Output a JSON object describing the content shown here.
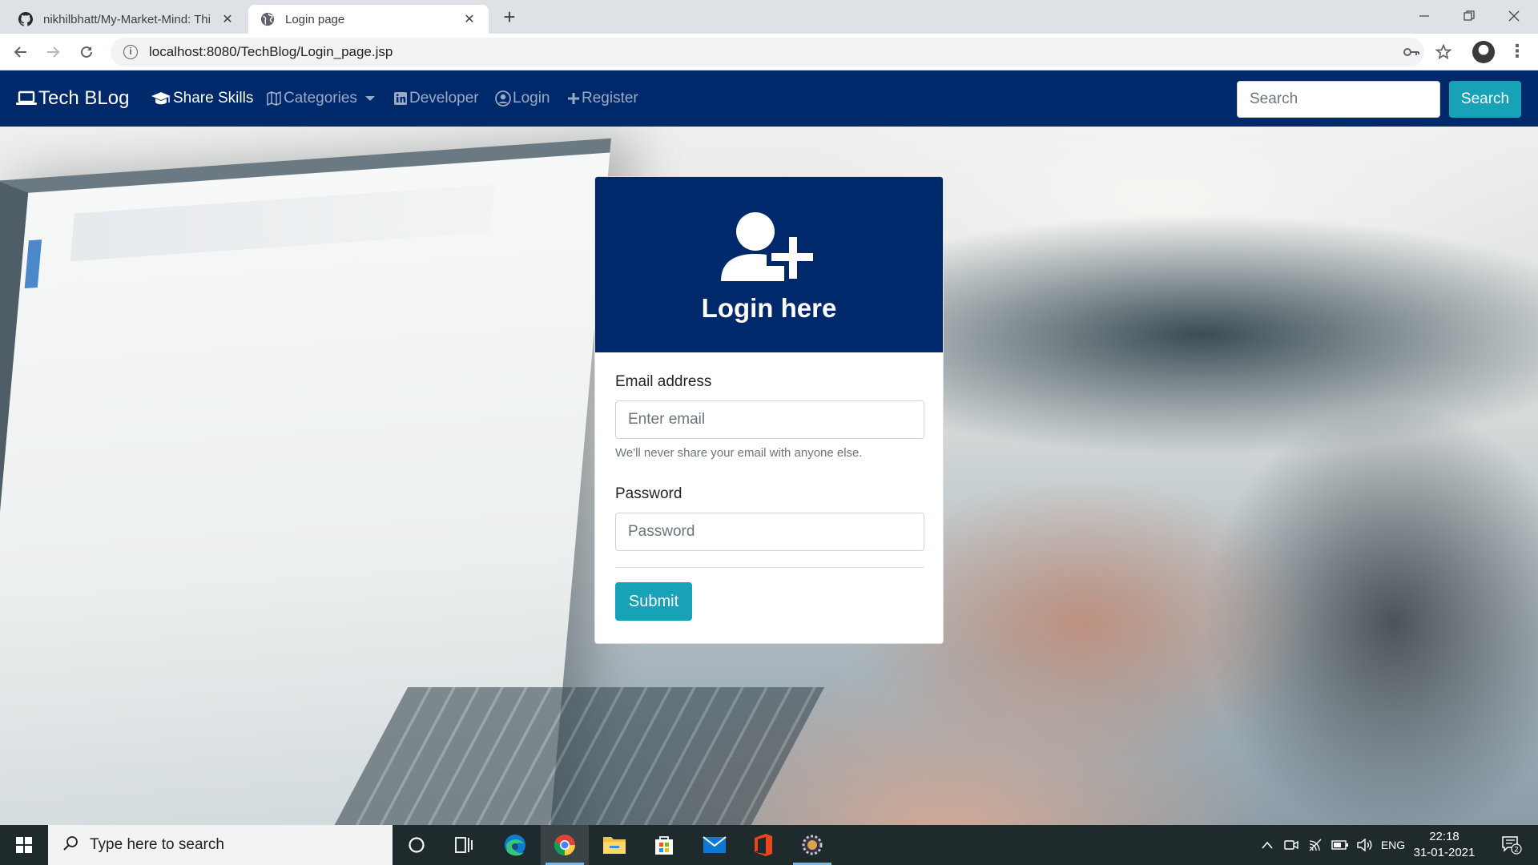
{
  "browser": {
    "tabs": [
      {
        "title": "nikhilbhatt/My-Market-Mind: Thi",
        "icon": "github-icon",
        "active": false
      },
      {
        "title": "Login page",
        "icon": "globe-icon",
        "active": true
      }
    ],
    "address_bar": {
      "url": "localhost:8080/TechBlog/Login_page.jsp"
    }
  },
  "site": {
    "brand": "Tech BLog",
    "nav": {
      "share_skills": "Share Skills",
      "categories": "Categories",
      "developer": "Developer",
      "login": "Login",
      "register": "Register"
    },
    "search": {
      "placeholder": "Search",
      "button": "Search"
    }
  },
  "login_card": {
    "title": "Login here",
    "email_label": "Email address",
    "email_placeholder": "Enter email",
    "email_help": "We'll never share your email with anyone else.",
    "password_label": "Password",
    "password_placeholder": "Password",
    "submit_label": "Submit"
  },
  "taskbar": {
    "search_placeholder": "Type here to search",
    "language": "ENG",
    "time": "22:18",
    "date": "31-01-2021",
    "notification_count": "2"
  },
  "colors": {
    "navbar": "#00296b",
    "accent": "#17a2b8",
    "taskbar": "#1e2a2c"
  }
}
